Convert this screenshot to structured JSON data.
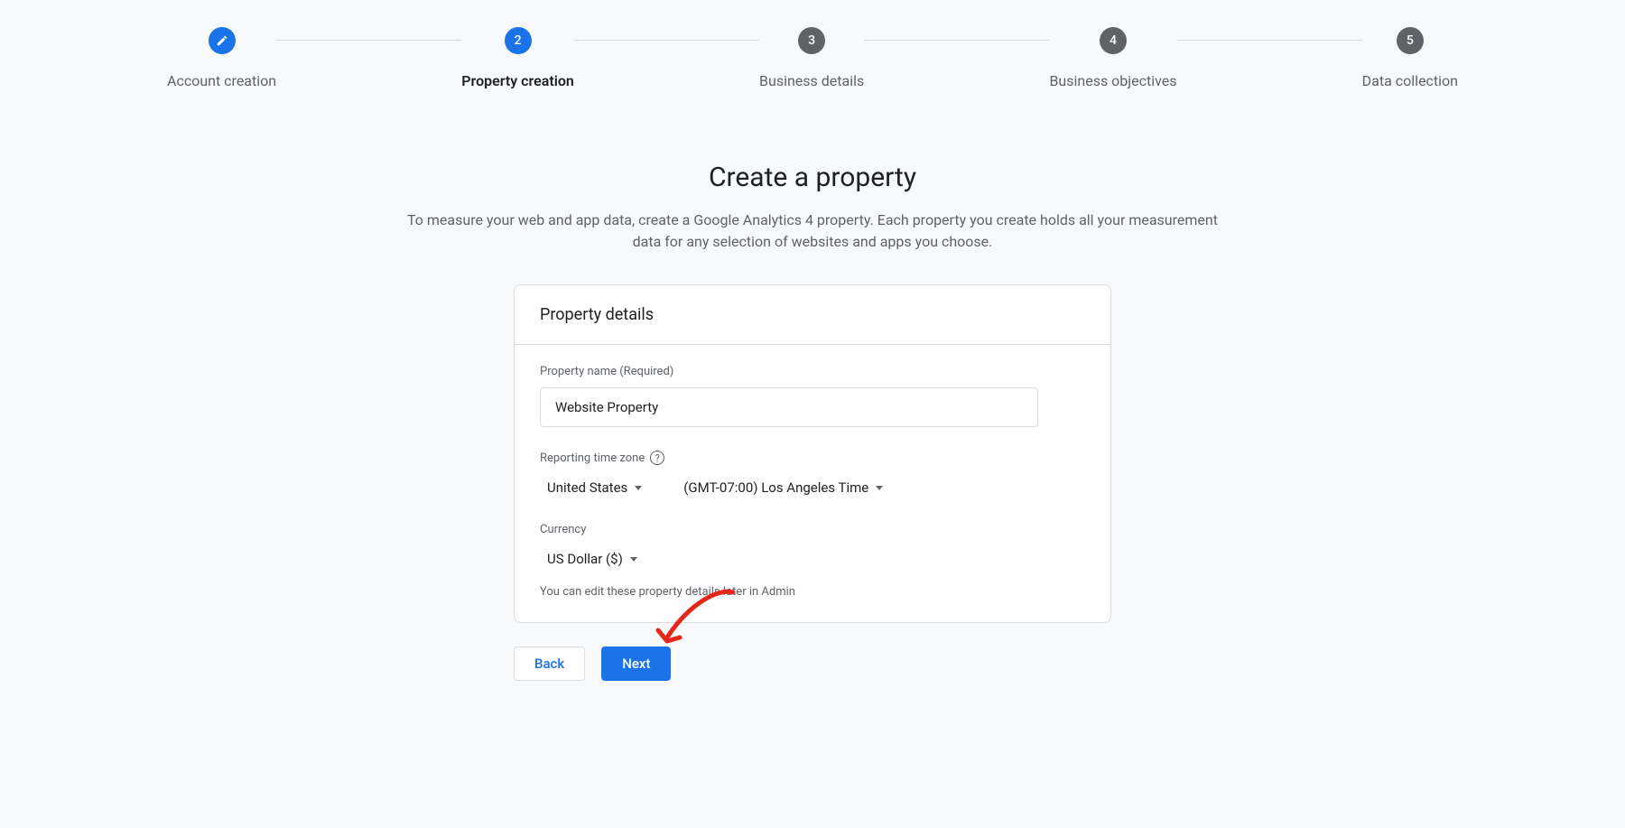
{
  "stepper": {
    "steps": [
      {
        "label": "Account creation",
        "state": "done",
        "marker": "pencil"
      },
      {
        "label": "Property creation",
        "state": "current",
        "marker": "2"
      },
      {
        "label": "Business details",
        "state": "todo",
        "marker": "3"
      },
      {
        "label": "Business objectives",
        "state": "todo",
        "marker": "4"
      },
      {
        "label": "Data collection",
        "state": "todo",
        "marker": "5"
      }
    ]
  },
  "header": {
    "title": "Create a property",
    "description": "To measure your web and app data, create a Google Analytics 4 property. Each property you create holds all your measurement data for any selection of websites and apps you choose."
  },
  "card": {
    "title": "Property details",
    "propertyName": {
      "label": "Property name (Required)",
      "value": "Website Property"
    },
    "timezone": {
      "label": "Reporting time zone",
      "country": "United States",
      "tz": "(GMT-07:00) Los Angeles Time"
    },
    "currency": {
      "label": "Currency",
      "value": "US Dollar ($)"
    },
    "hint": "You can edit these property details later in Admin"
  },
  "buttons": {
    "back": "Back",
    "next": "Next"
  }
}
